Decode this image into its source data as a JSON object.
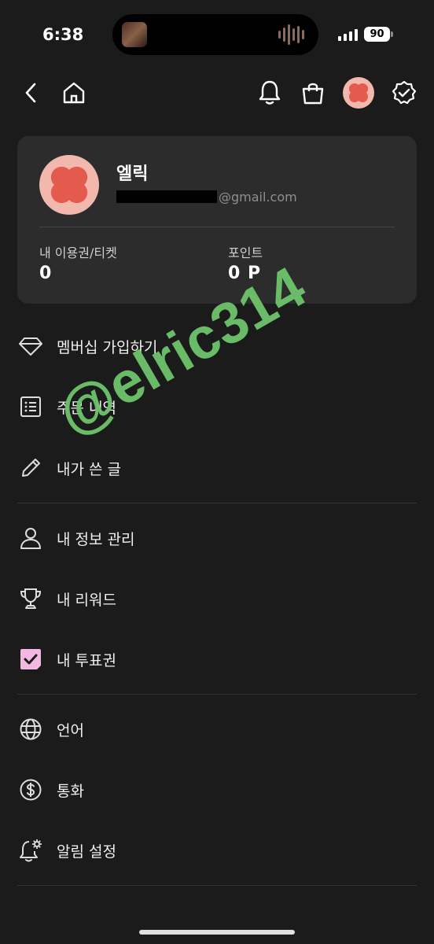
{
  "status_bar": {
    "time": "6:38",
    "battery": "90"
  },
  "profile": {
    "name": "엘릭",
    "email_domain": "@gmail.com",
    "tickets_label": "내 이용권/티켓",
    "tickets_value": "0",
    "points_label": "포인트",
    "points_value": "0 P"
  },
  "menu": {
    "membership": "멤버십 가입하기",
    "orders": "주문 내역",
    "my_posts": "내가 쓴 글",
    "my_info": "내 정보 관리",
    "rewards": "내 리워드",
    "vote_tickets": "내 투표권",
    "language": "언어",
    "currency": "통화",
    "notification_settings": "알림 설정"
  },
  "watermark": "@elric314",
  "colors": {
    "background": "#1b1b1b",
    "card": "#2c2c2c",
    "avatar": "#f3b8ad",
    "avatar_flower": "#e45a4f",
    "vote_icon": "#f2b8df",
    "watermark": "#6dc26b"
  }
}
